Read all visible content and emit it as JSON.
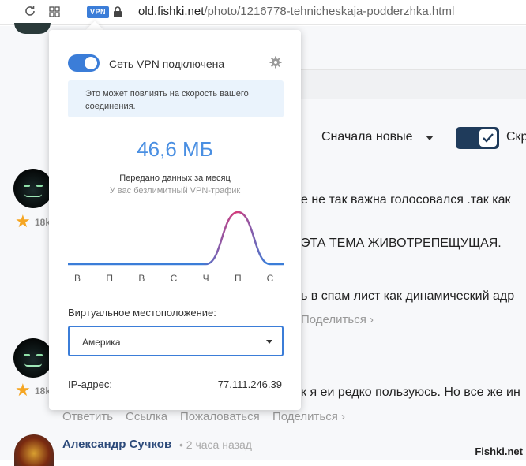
{
  "browser": {
    "vpn_badge": "VPN",
    "url_domain": "old.fishki.net",
    "url_path": "/photo/1216778-tehnicheskaja-podderzhka.html"
  },
  "page": {
    "sort_label": "Сначала новые",
    "toggle_cut_label": "Скр",
    "comments": [
      {
        "karma": "18k",
        "line1": "е не так важна голосовался .так как",
        "line2": "ЭТА ТЕМА ЖИВОТРЕПЕЩУЩАЯ.",
        "line3": "ь в спам лист как динамический адр",
        "share": "Поделиться ›"
      },
      {
        "karma": "18k",
        "line1": "к я еи редко пользуюсь. Но все же ин"
      }
    ],
    "actions": {
      "reply": "Ответить",
      "link": "Ссылка",
      "complain": "Пожаловаться",
      "share": "Поделиться ›"
    },
    "next_author": {
      "name": "Александр Сучков",
      "time": "• 2 часа назад"
    },
    "watermark": "Fishki.net"
  },
  "popup": {
    "vpn_status": "Сеть VPN подключена",
    "vpn_enabled": true,
    "notice": "Это может повлиять на скорость вашего соединения.",
    "traffic_value": "46,6 МБ",
    "traffic_caption": "Передано данных за месяц",
    "unlimited_caption": "У вас безлимитный VPN-трафик",
    "location_label": "Виртуальное местоположение:",
    "location_value": "Америка",
    "ip_label": "IP-адрес:",
    "ip_value": "77.111.246.39"
  },
  "chart_data": {
    "type": "line",
    "categories": [
      "В",
      "П",
      "В",
      "С",
      "Ч",
      "П",
      "С"
    ],
    "values": [
      0,
      0,
      0,
      0,
      0,
      46.6,
      0
    ]
  },
  "colors": {
    "accent": "#3b7dd8",
    "traffic_text": "#4a8fe2",
    "line_start": "#3b7dd8",
    "line_peak": "#d63a7a",
    "link_author": "#2c4a7a"
  },
  "icons": {
    "reload": "reload-icon",
    "tabs": "tabs-grid-icon",
    "lock": "lock-icon",
    "settings": "gear-icon",
    "dropdown": "chevron-down-icon",
    "star": "star-icon",
    "check": "checkmark-icon"
  }
}
